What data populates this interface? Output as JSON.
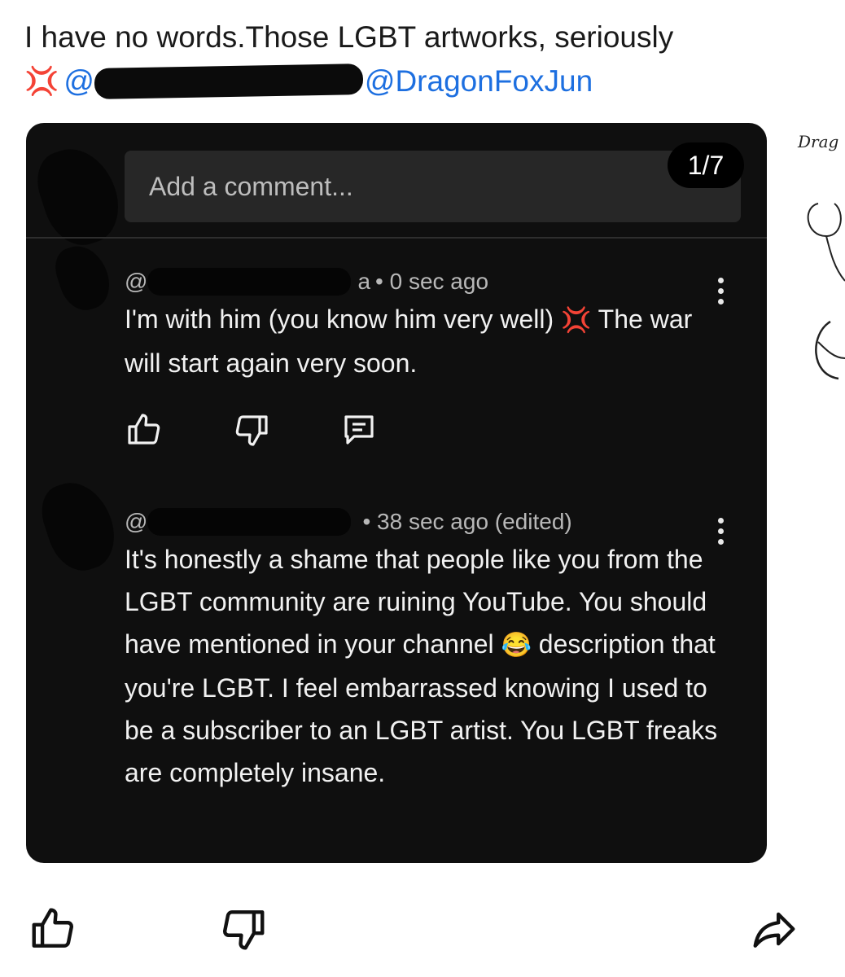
{
  "post": {
    "text": "I have no words.Those LGBT artworks, seriously",
    "anger_emoji": "💢",
    "mention_visible_prefix": "@",
    "mention_tail": "@DragonFoxJun"
  },
  "card": {
    "counter": "1/7",
    "comment_placeholder": "Add a comment...",
    "comments": [
      {
        "handle_visible": "@",
        "handle_tail": "a",
        "time": "• 0 sec ago",
        "text_before": "I'm with him (you know him very well) ",
        "emoji": "💢",
        "text_after": " The war will start again very soon."
      },
      {
        "handle_visible": "@",
        "handle_tail": "",
        "time": "• 38 sec ago (edited)",
        "text_before": "It's honestly a shame that people like you from the LGBT community are ruining YouTube. You should have mentioned in your channel ",
        "emoji": "😂",
        "text_after": " description that you're LGBT. I feel embarrassed knowing I used to be a subscriber to an LGBT artist. You LGBT freaks are completely insane."
      }
    ],
    "actions": [
      "like-icon",
      "dislike-icon",
      "reply-icon"
    ]
  },
  "side_art": {
    "label": "Drag"
  },
  "bottom_actions": [
    "like-icon",
    "dislike-icon",
    "share-icon"
  ],
  "colors": {
    "mention": "#1d6fe0",
    "card_bg": "#0f0f0f",
    "input_bg": "#272727",
    "anger": "#e03a2e"
  }
}
